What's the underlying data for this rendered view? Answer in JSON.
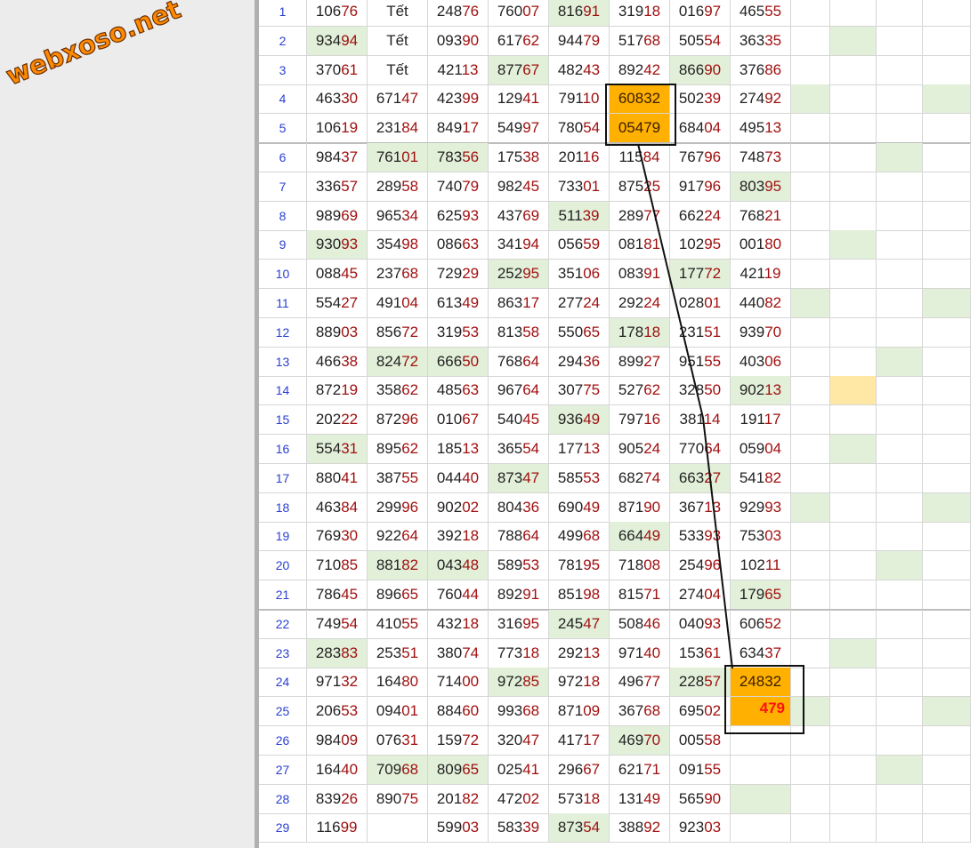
{
  "logo": {
    "text": "webxoso.net"
  },
  "table": {
    "rows": [
      {
        "n": "1",
        "v": [
          "10676",
          "Tết",
          "24876",
          "76007",
          "81691",
          "31918",
          "01697",
          "46555"
        ],
        "hl": [
          4
        ],
        "ex": []
      },
      {
        "n": "2",
        "v": [
          "93494",
          "Tết",
          "09390",
          "61762",
          "94479",
          "51768",
          "50554",
          "36335"
        ],
        "hl": [
          0
        ],
        "ex": [
          9
        ]
      },
      {
        "n": "3",
        "v": [
          "37061",
          "Tết",
          "42113",
          "87767",
          "48243",
          "89242",
          "86690",
          "37686"
        ],
        "hl": [
          3,
          6
        ],
        "ex": []
      },
      {
        "n": "4",
        "v": [
          "46330",
          "67147",
          "42399",
          "12941",
          "79110",
          "60832",
          "50239",
          "27492"
        ],
        "hl": [],
        "ex": [
          8,
          11
        ]
      },
      {
        "n": "5",
        "v": [
          "10619",
          "23184",
          "84917",
          "54997",
          "78054",
          "05479",
          "68404",
          "49513"
        ],
        "hl": [],
        "ex": []
      },
      {
        "n": "6",
        "v": [
          "98437",
          "76101",
          "78356",
          "17538",
          "20116",
          "11584",
          "76796",
          "74873"
        ],
        "hl": [
          1,
          2
        ],
        "ex": [
          10
        ]
      },
      {
        "n": "7",
        "v": [
          "33657",
          "28958",
          "74079",
          "98245",
          "73301",
          "87525",
          "91796",
          "80395"
        ],
        "hl": [
          7
        ],
        "ex": []
      },
      {
        "n": "8",
        "v": [
          "98969",
          "96534",
          "62593",
          "43769",
          "51139",
          "28977",
          "66224",
          "76821"
        ],
        "hl": [
          4
        ],
        "ex": []
      },
      {
        "n": "9",
        "v": [
          "93093",
          "35498",
          "08663",
          "34194",
          "05659",
          "08181",
          "10295",
          "00180"
        ],
        "hl": [
          0
        ],
        "ex": [
          9
        ]
      },
      {
        "n": "10",
        "v": [
          "08845",
          "23768",
          "72929",
          "25295",
          "35106",
          "08391",
          "17772",
          "42119"
        ],
        "hl": [
          3,
          6
        ],
        "ex": []
      },
      {
        "n": "11",
        "v": [
          "55427",
          "49104",
          "61349",
          "86317",
          "27724",
          "29224",
          "02801",
          "44082"
        ],
        "hl": [],
        "ex": [
          8,
          11
        ]
      },
      {
        "n": "12",
        "v": [
          "88903",
          "85672",
          "31953",
          "81358",
          "55065",
          "17818",
          "23151",
          "93970"
        ],
        "hl": [
          5
        ],
        "ex": []
      },
      {
        "n": "13",
        "v": [
          "46638",
          "82472",
          "66650",
          "76864",
          "29436",
          "89927",
          "95155",
          "40306"
        ],
        "hl": [
          1,
          2
        ],
        "ex": [
          10
        ]
      },
      {
        "n": "14",
        "v": [
          "87219",
          "35862",
          "48563",
          "96764",
          "30775",
          "52762",
          "32850",
          "90213"
        ],
        "hl": [
          7
        ],
        "ex": [],
        "yl": [
          9
        ]
      },
      {
        "n": "15",
        "v": [
          "20222",
          "87296",
          "01067",
          "54045",
          "93649",
          "79716",
          "38114",
          "19117"
        ],
        "hl": [
          4
        ],
        "ex": []
      },
      {
        "n": "16",
        "v": [
          "55431",
          "89562",
          "18513",
          "36554",
          "17713",
          "90524",
          "77064",
          "05904"
        ],
        "hl": [
          0
        ],
        "ex": [
          9
        ]
      },
      {
        "n": "17",
        "v": [
          "88041",
          "38755",
          "04440",
          "87347",
          "58553",
          "68274",
          "66327",
          "54182"
        ],
        "hl": [
          3,
          6
        ],
        "ex": []
      },
      {
        "n": "18",
        "v": [
          "46384",
          "29996",
          "90202",
          "80436",
          "69049",
          "87190",
          "36713",
          "92993"
        ],
        "hl": [],
        "ex": [
          8,
          11
        ]
      },
      {
        "n": "19",
        "v": [
          "76930",
          "92264",
          "39218",
          "78864",
          "49968",
          "66449",
          "53393",
          "75303"
        ],
        "hl": [
          5
        ],
        "ex": []
      },
      {
        "n": "20",
        "v": [
          "71085",
          "88182",
          "04348",
          "58953",
          "78195",
          "71808",
          "25496",
          "10211"
        ],
        "hl": [
          1,
          2
        ],
        "ex": [
          10
        ]
      },
      {
        "n": "21",
        "v": [
          "78645",
          "89665",
          "76044",
          "89291",
          "85198",
          "81571",
          "27404",
          "17965"
        ],
        "hl": [
          7
        ],
        "ex": []
      },
      {
        "n": "22",
        "v": [
          "74954",
          "41055",
          "43218",
          "31695",
          "24547",
          "50846",
          "04093",
          "60652"
        ],
        "hl": [
          4
        ],
        "ex": []
      },
      {
        "n": "23",
        "v": [
          "28383",
          "25351",
          "38074",
          "77318",
          "29213",
          "97140",
          "15361",
          "63437"
        ],
        "hl": [
          0
        ],
        "ex": [
          9
        ]
      },
      {
        "n": "24",
        "v": [
          "97132",
          "16480",
          "71400",
          "97285",
          "97218",
          "49677",
          "22857",
          "24832"
        ],
        "hl": [
          3,
          6
        ],
        "ex": []
      },
      {
        "n": "25",
        "v": [
          "20653",
          "09401",
          "88460",
          "99368",
          "87109",
          "36768",
          "69502",
          ""
        ],
        "hl": [],
        "ex": [
          8,
          11
        ]
      },
      {
        "n": "26",
        "v": [
          "98409",
          "07631",
          "15972",
          "32047",
          "41717",
          "46970",
          "00558",
          ""
        ],
        "hl": [
          5
        ],
        "ex": []
      },
      {
        "n": "27",
        "v": [
          "16440",
          "70968",
          "80965",
          "02541",
          "29667",
          "62171",
          "09155",
          ""
        ],
        "hl": [
          1,
          2
        ],
        "ex": [
          10
        ]
      },
      {
        "n": "28",
        "v": [
          "83926",
          "89075",
          "20182",
          "47202",
          "57318",
          "13149",
          "56590",
          ""
        ],
        "hl": [
          7
        ],
        "ex": []
      },
      {
        "n": "29",
        "v": [
          "11699",
          "",
          "59903",
          "58339",
          "87354",
          "38892",
          "92303",
          ""
        ],
        "hl": [
          4
        ],
        "ex": []
      }
    ]
  },
  "prediction": {
    "value": "479"
  },
  "colors": {
    "highlight_green": "#e2f0d9",
    "highlight_orange": "#ffb000",
    "highlight_yellow": "#ffe8a6",
    "digit_red": "#a01010",
    "prediction_red": "#ff1010",
    "row_number_blue": "#2a3fd1",
    "logo_orange": "#ff8a00"
  }
}
